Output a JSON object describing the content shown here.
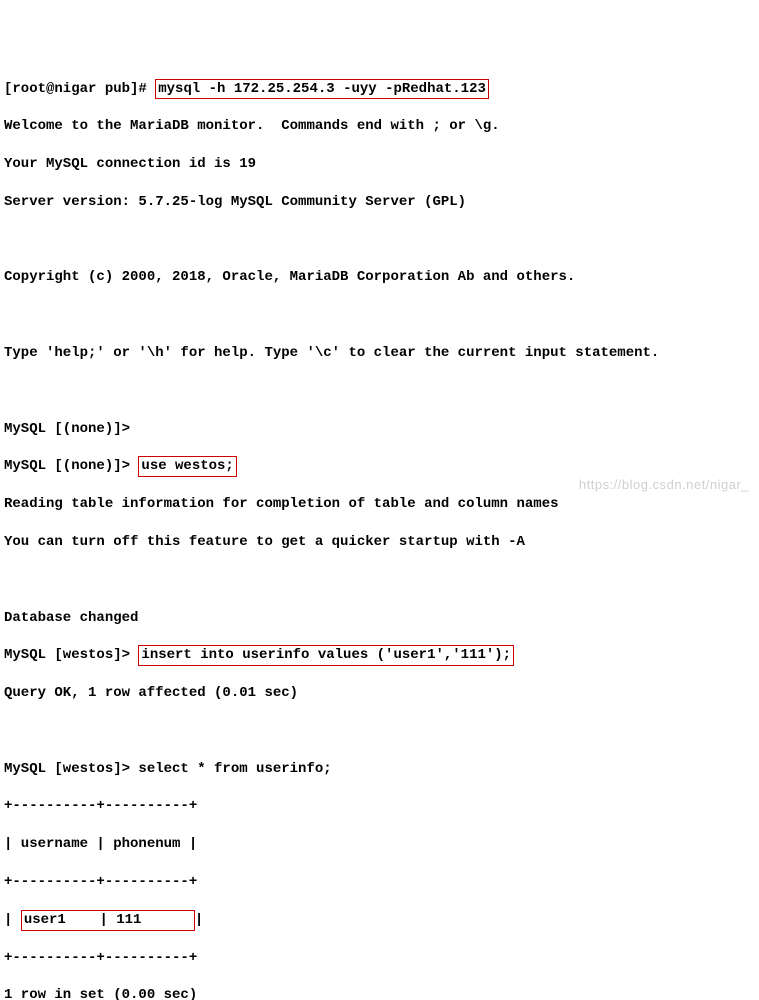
{
  "shell": {
    "prompt": "[root@nigar pub]# ",
    "cmd": "mysql -h 172.25.254.3 -uyy -pRedhat.123"
  },
  "welcome": {
    "line1": "Welcome to the MariaDB monitor.  Commands end with ; or \\g.",
    "line2": "Your MySQL connection id is 19",
    "line3": "Server version: 5.7.25-log MySQL Community Server (GPL)",
    "copyright": "Copyright (c) 2000, 2018, Oracle, MariaDB Corporation Ab and others.",
    "help": "Type 'help;' or '\\h' for help. Type '\\c' to clear the current input statement."
  },
  "sql": {
    "prompt_none": "MySQL [(none)]> ",
    "prompt_westos": "MySQL [westos]> ",
    "use_cmd": "use westos;",
    "reading1": "Reading table information for completion of table and column names",
    "reading2": "You can turn off this feature to get a quicker startup with -A",
    "db_changed": "Database changed",
    "insert_cmd": "insert into userinfo values ('user1','111');",
    "insert_result": "Query OK, 1 row affected (0.01 sec)",
    "select_cmd": "select * from userinfo;",
    "table_border": "+----------+----------+",
    "table_header": "| username | phonenum |",
    "table_row_prefix": "| ",
    "table_row_user": "user1    ",
    "table_row_sep": "| ",
    "table_row_phone": "111      ",
    "table_row_suffix": "|",
    "row_count": "1 row in set (0.00 sec)"
  },
  "watermark": "https://blog.csdn.net/nigar_"
}
